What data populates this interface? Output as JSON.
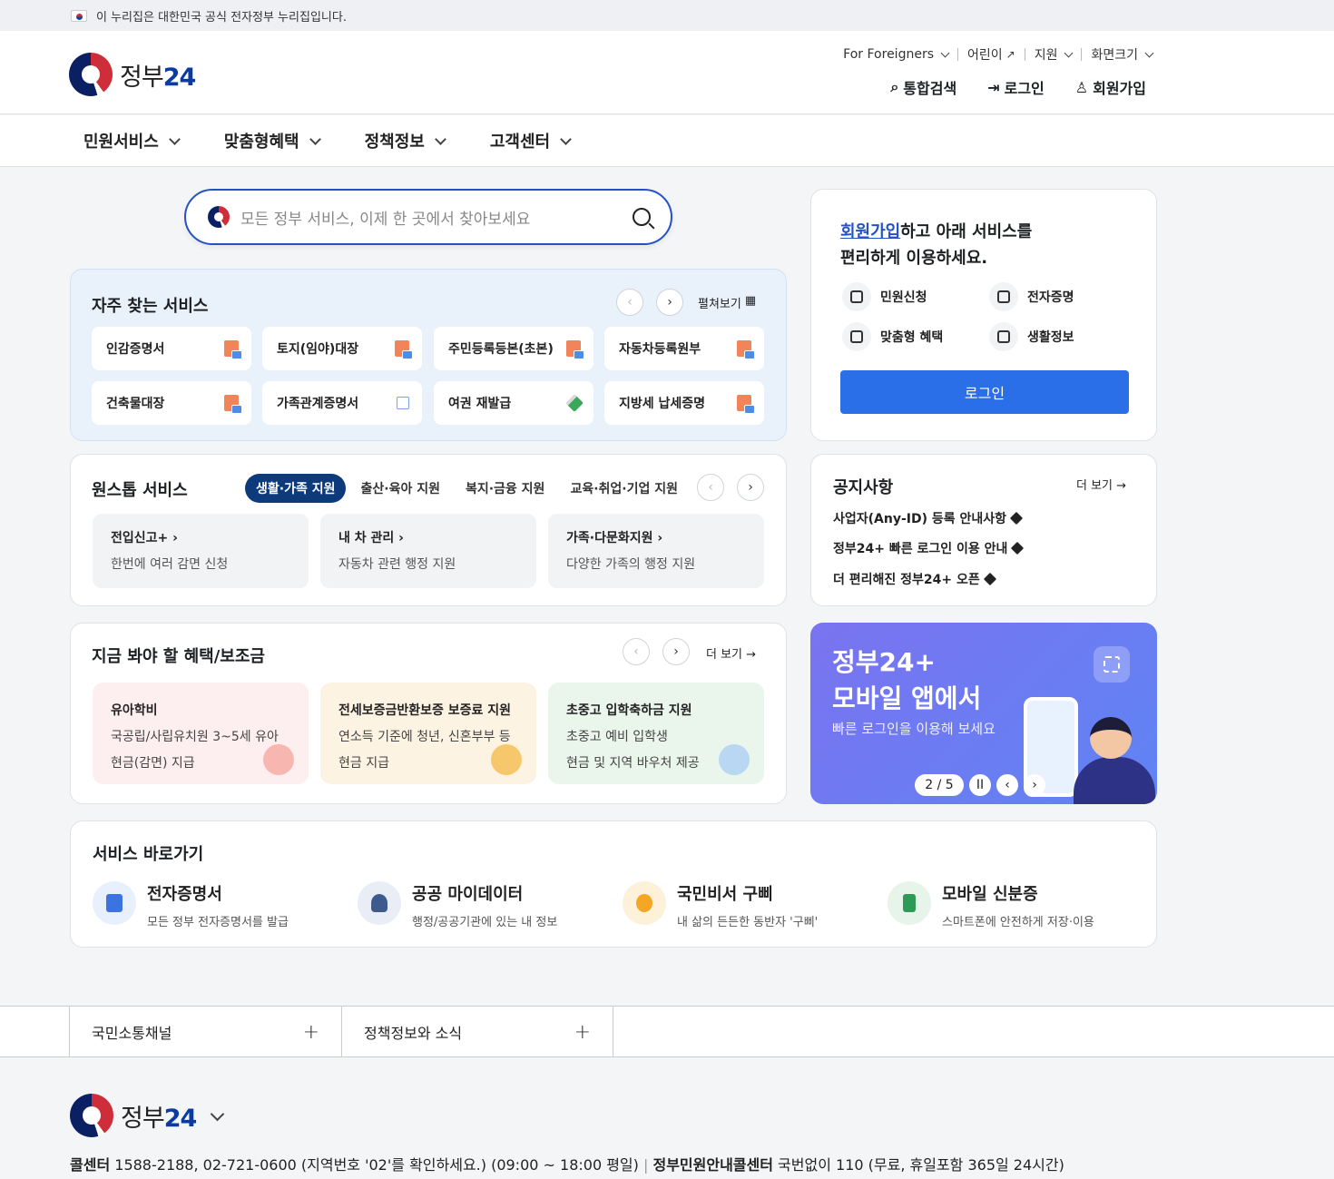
{
  "gov_banner": {
    "text": "이 누리집은 대한민국 공식 전자정부 누리집입니다."
  },
  "header": {
    "logo_text_a": "정부",
    "logo_text_b": "24",
    "util": [
      {
        "label": "For Foreigners"
      },
      {
        "label": "어린이"
      },
      {
        "label": "지원"
      },
      {
        "label": "화면크기"
      }
    ],
    "actions": {
      "search": "통합검색",
      "login": "로그인",
      "signup": "회원가입"
    }
  },
  "gnb": [
    "민원서비스",
    "맞춤형혜택",
    "정책정보",
    "고객센터"
  ],
  "search": {
    "placeholder": "모든 정부 서비스, 이제 한 곳에서 찾아보세요"
  },
  "frequent": {
    "title": "자주 찾는 서비스",
    "expand": "펼쳐보기",
    "items": [
      "인감증명서",
      "토지(임야)대장",
      "주민등록등본(초본)",
      "자동차등록원부",
      "건축물대장",
      "가족관계증명서",
      "여권 재발급",
      "지방세 납세증명"
    ]
  },
  "onestop": {
    "title": "원스톱 서비스",
    "tabs": [
      "생활·가족 지원",
      "출산·육아 지원",
      "복지·금융 지원",
      "교육·취업·기업 지원"
    ],
    "cards": [
      {
        "title": "전입신고+",
        "desc": "한번에 여러 감면 신청"
      },
      {
        "title": "내 차 관리",
        "desc": "자동차 관련 행정 지원"
      },
      {
        "title": "가족·다문화지원",
        "desc": "다양한 가족의 행정 지원"
      }
    ]
  },
  "benefit": {
    "title": "지금 봐야 할 혜택/보조금",
    "more": "더 보기",
    "cards": [
      {
        "title": "유아학비",
        "line1": "국공립/사립유치원 3~5세 유아",
        "line2": "현금(감면) 지급",
        "bg": "#fdeef0"
      },
      {
        "title": "전세보증금반환보증 보증료 지원",
        "line1": "연소득 기준에 청년, 신혼부부 등",
        "line2": "현금 지급",
        "bg": "#fdf3e3"
      },
      {
        "title": "초중고 입학축하금 지원",
        "line1": "초중고 예비 입학생",
        "line2": "현금 및 지역 바우처 제공",
        "bg": "#eaf5ec"
      }
    ]
  },
  "login_card": {
    "highlight": "회원가입",
    "line1_rest": "하고 아래 서비스를",
    "line2": "편리하게 이용하세요.",
    "services": [
      "민원신청",
      "전자증명",
      "맞춤형 혜택",
      "생활정보"
    ],
    "button": "로그인"
  },
  "notice": {
    "title": "공지사항",
    "more": "더 보기",
    "items": [
      "사업자(Any-ID) 등록 안내사항",
      "정부24+ 빠른 로그인 이용 안내",
      "더 편리해진 정부24+ 오픈"
    ]
  },
  "promo": {
    "line1": "정부24+",
    "line2": "모바일 앱에서",
    "sub": "빠른 로그인을 이용해 보세요",
    "pager": "2 / 5"
  },
  "quick": {
    "title": "서비스 바로가기",
    "items": [
      {
        "title": "전자증명서",
        "desc": "모든 정부 전자증명서를 발급"
      },
      {
        "title": "공공 마이데이터",
        "desc": "행정/공공기관에 있는 내 정보"
      },
      {
        "title": "국민비서 구삐",
        "desc": "내 삶의 든든한 동반자 '구삐'"
      },
      {
        "title": "모바일 신분증",
        "desc": "스마트폰에 안전하게 저장·이용"
      }
    ]
  },
  "footer": {
    "bar": [
      "국민소통채널",
      "정책정보와 소식"
    ],
    "call_label": "콜센터",
    "call_text": "1588-2188, 02-721-0600 (지역번호 '02'를 확인하세요.) (09:00 ~ 18:00 평일)",
    "center_label": "정부민원안내콜센터",
    "center_text": "국번없이 110 (무료, 휴일포함 365일 24시간)"
  },
  "colors": {
    "primary": "#2452c6",
    "navy": "#0c3a7a",
    "button": "#2a6ee8"
  }
}
